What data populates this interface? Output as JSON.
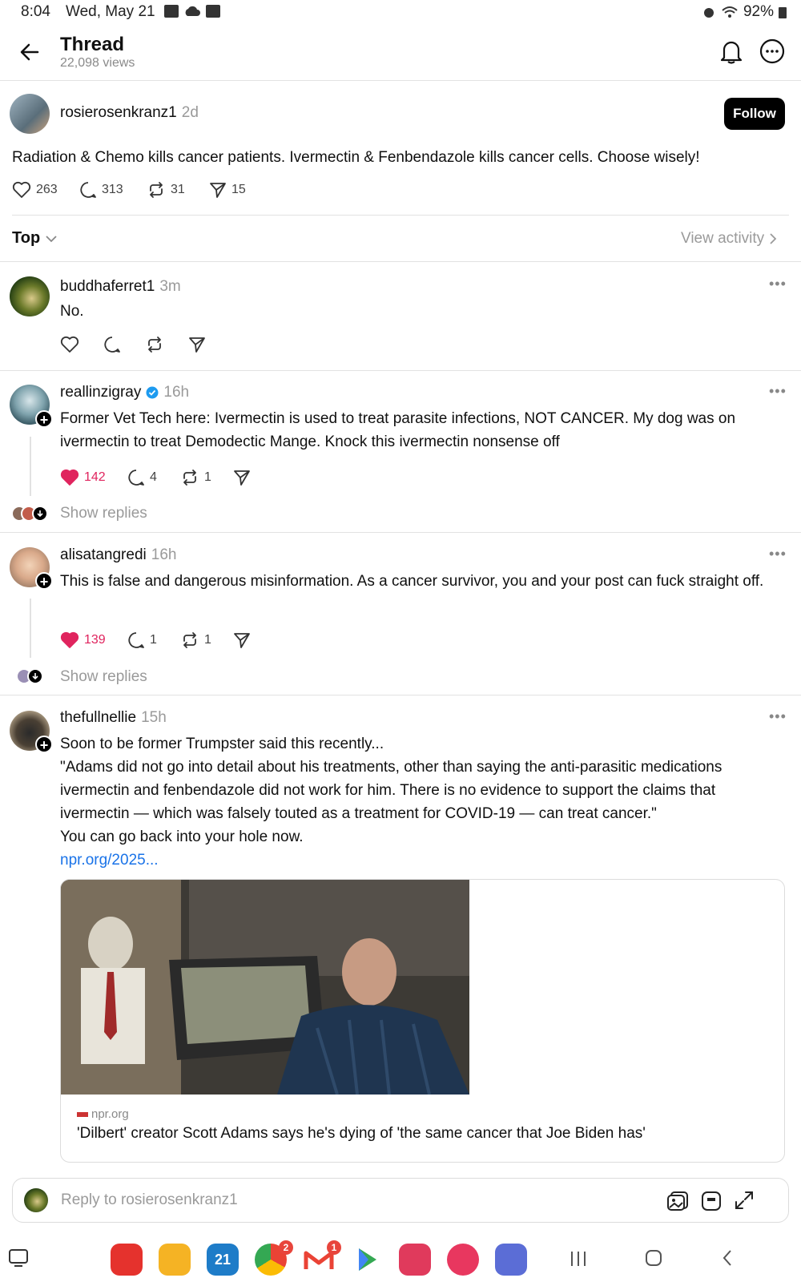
{
  "status_bar": {
    "time": "8:04",
    "date": "Wed, May 21",
    "battery": "92%"
  },
  "header": {
    "title": "Thread",
    "views": "22,098 views"
  },
  "original_post": {
    "username": "rosierosenkranz1",
    "time": "2d",
    "follow_label": "Follow",
    "text": "Radiation & Chemo kills cancer patients. Ivermectin & Fenbendazole kills cancer cells. Choose wisely!",
    "likes": "263",
    "comments": "313",
    "reposts": "31",
    "shares": "15"
  },
  "sort_bar": {
    "sort_label": "Top",
    "view_activity": "View activity"
  },
  "replies": [
    {
      "username": "buddhaferret1",
      "time": "3m",
      "text": "No."
    },
    {
      "username": "reallinzigray",
      "time": "16h",
      "text": "Former Vet Tech here: Ivermectin is used to treat parasite infections, NOT CANCER. My dog was on ivermectin to treat Demodectic Mange. Knock this ivermectin nonsense off",
      "likes": "142",
      "comments": "4",
      "reposts": "1",
      "show_replies": "Show replies"
    },
    {
      "username": "alisatangredi",
      "time": "16h",
      "text": "This is false and dangerous misinformation. As a cancer survivor, you and your post can fuck straight off.",
      "likes": "139",
      "comments": "1",
      "reposts": "1",
      "show_replies": "Show replies"
    },
    {
      "username": "thefullnellie",
      "time": "15h",
      "lines": [
        "Soon to be former Trumpster said this recently...",
        "\"Adams did not go into detail about his treatments, other than saying the anti-parasitic medications ivermectin and fenbendazole did not work for him. There is no evidence to support the claims that ivermectin — which was falsely touted as a treatment for COVID-19 — can treat cancer.\"",
        "You can go back into your hole now."
      ],
      "link": "npr.org/2025...",
      "card_domain": "npr.org",
      "card_title": "'Dilbert' creator Scott Adams says he's dying of 'the same cancer that Joe Biden has'"
    }
  ],
  "reply_bar": {
    "placeholder": "Reply to rosierosenkranz1"
  },
  "dock": {
    "calendar_day": "21",
    "chrome_badge": "2",
    "gmail_badge": "1"
  },
  "colors": {
    "like_red": "#e0245e",
    "link_blue": "#1a73e8",
    "verified_blue": "#1d9bf0"
  }
}
